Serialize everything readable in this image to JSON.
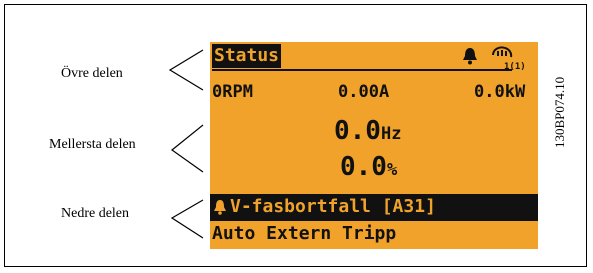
{
  "labels": {
    "upper": "Övre delen",
    "middle": "Mellersta delen",
    "lower": "Nedre delen"
  },
  "display": {
    "status_word": "Status",
    "hand_marker": "1(1)",
    "speed": "0RPM",
    "current": "0.00A",
    "power": "0.0kW",
    "frequency_value": "0.0",
    "frequency_unit": "Hz",
    "percent_value": "0.0",
    "percent_unit": "%",
    "alarm_message": "V-fasbortfall [A31]",
    "bottom_message": "Auto Extern Tripp"
  },
  "figure_code": "130BP074.10",
  "colors": {
    "lcd_background": "#f0a22a",
    "lcd_ink": "#111111"
  },
  "icons": [
    "bell-icon",
    "hand-icon",
    "alarm-bell-icon"
  ]
}
